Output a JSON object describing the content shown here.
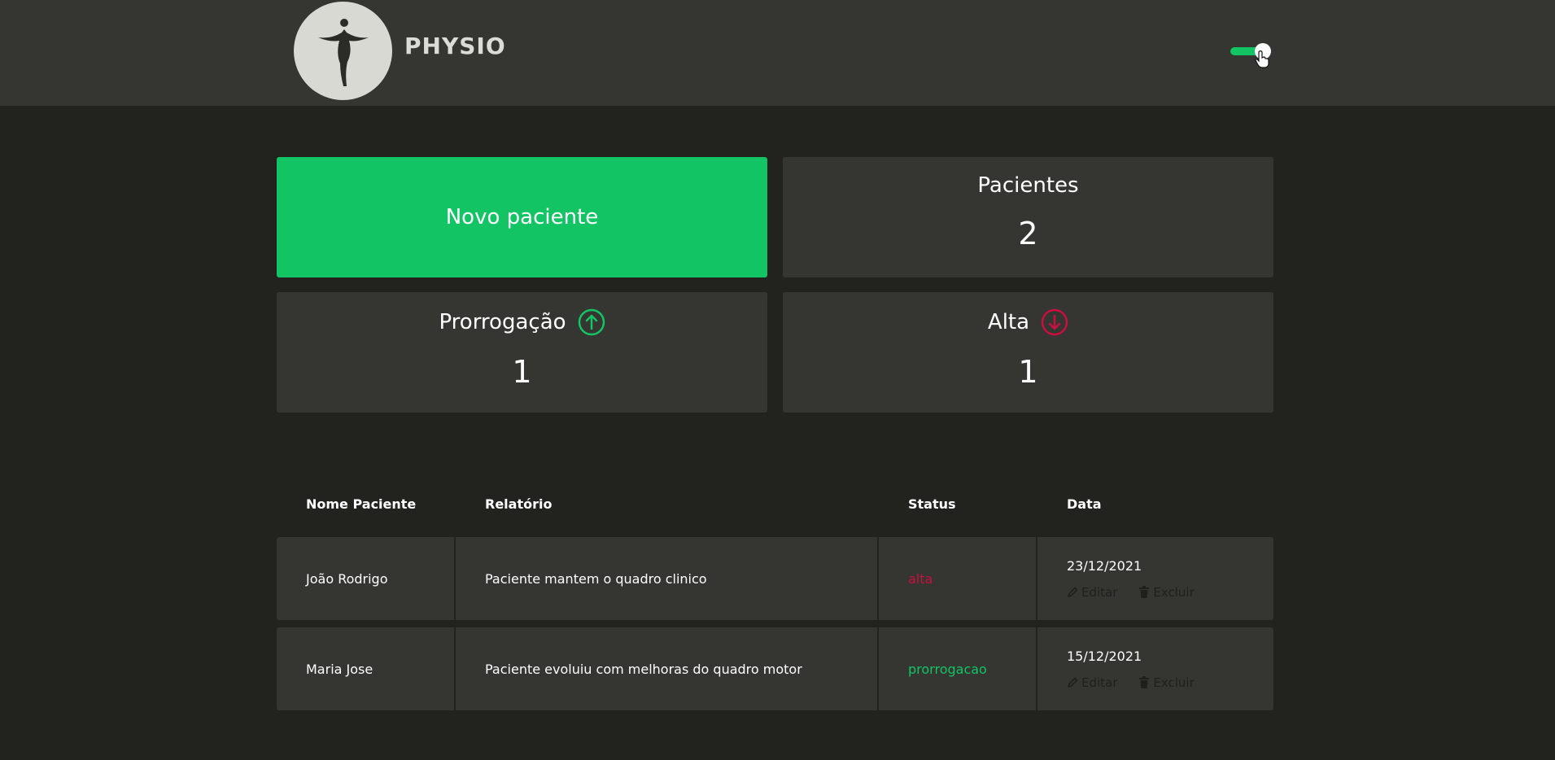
{
  "header": {
    "logo_text": "PHYSIO",
    "theme_toggle_on": true
  },
  "cards": {
    "new_patient_label": "Novo paciente",
    "patients": {
      "title": "Pacientes",
      "value": "2"
    },
    "extension": {
      "title": "Prorrogação",
      "value": "1",
      "icon": "arrow-up-circle-icon",
      "color": "#12c464"
    },
    "discharge": {
      "title": "Alta",
      "value": "1",
      "icon": "arrow-down-circle-icon",
      "color": "#c8103f"
    }
  },
  "table": {
    "headers": [
      "Nome Paciente",
      "Relatório",
      "Status",
      "Data"
    ],
    "rows": [
      {
        "name": "João Rodrigo",
        "report": "Paciente mantem o quadro clinico",
        "status": "alta",
        "date": "23/12/2021",
        "edit": "Editar",
        "delete": "Excluir"
      },
      {
        "name": "Maria Jose",
        "report": "Paciente evoluiu com melhoras do quadro motor",
        "status": "prorrogacao",
        "date": "15/12/2021",
        "edit": "Editar",
        "delete": "Excluir"
      }
    ]
  },
  "colors": {
    "accent": "#12c464",
    "danger": "#c8103f",
    "background": "#22221f",
    "surface": "#353532"
  }
}
